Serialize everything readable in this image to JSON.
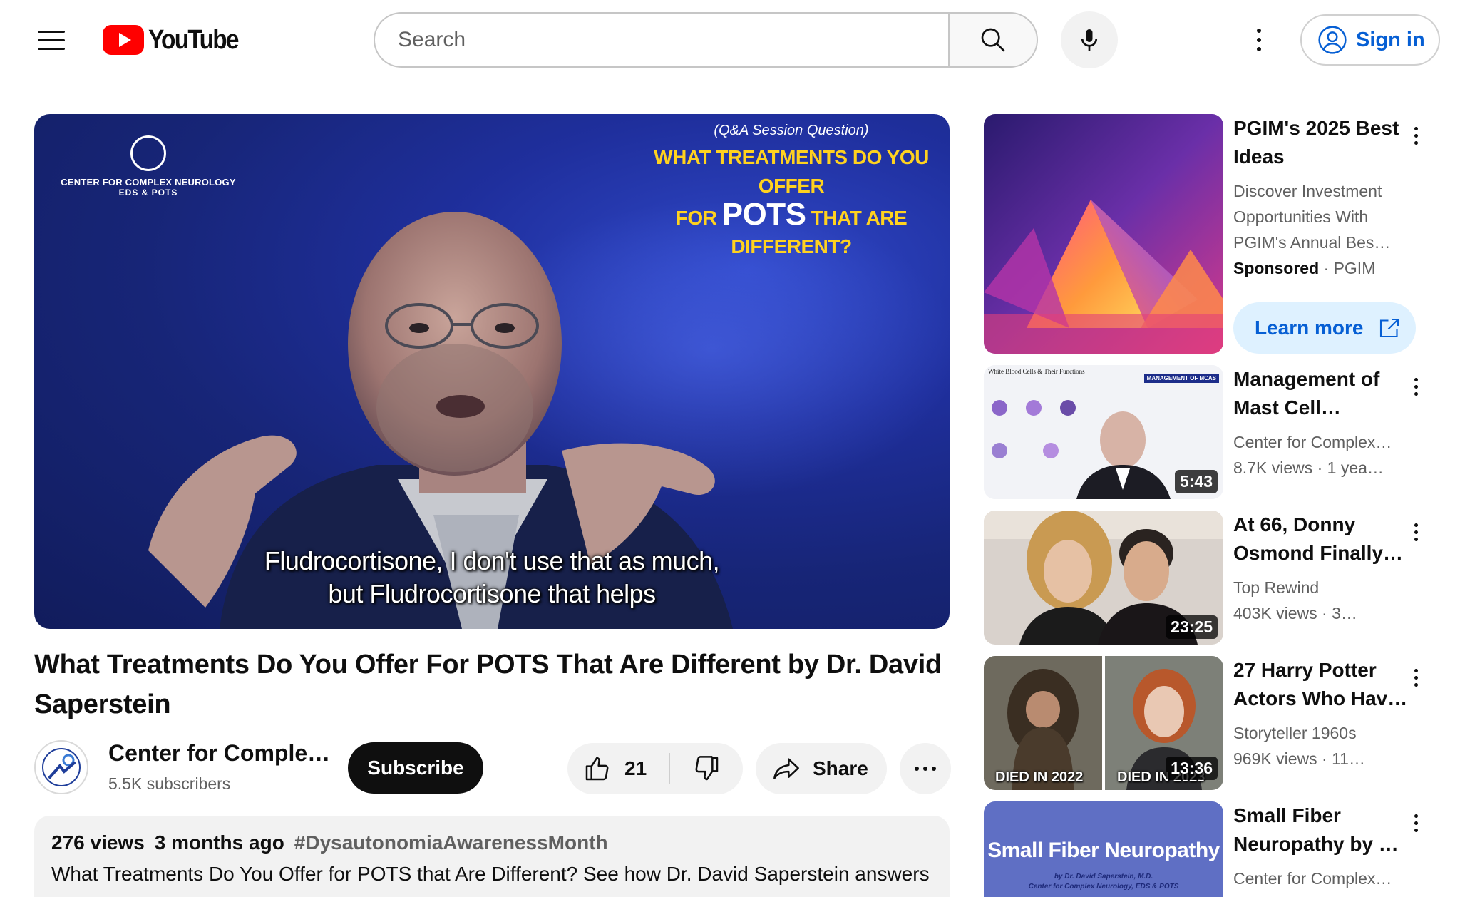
{
  "header": {
    "logo_text": "YouTube",
    "search_placeholder": "Search",
    "sign_in_label": "Sign in"
  },
  "player": {
    "overlay_org_line1": "CENTER FOR COMPLEX NEUROLOGY",
    "overlay_org_line2": "EDS & POTS",
    "overlay_caption": "(Q&A Session Question)",
    "overlay_title_line1": "WHAT TREATMENTS DO YOU OFFER",
    "overlay_title_for": "FOR",
    "overlay_title_pots": "POTS",
    "overlay_title_line2_end": "THAT ARE DIFFERENT?",
    "subtitle_line1": "Fludrocortisone, I don't use that as much,",
    "subtitle_line2": "but Fludrocortisone that helps"
  },
  "video": {
    "title": "What Treatments Do You Offer For POTS That Are Different by Dr. David Saperstein",
    "channel_name": "Center for Comple…",
    "subscribers": "5.5K subscribers",
    "subscribe_label": "Subscribe",
    "likes": "21",
    "share_label": "Share",
    "views": "276 views",
    "date": "3 months ago",
    "hashtag": "#DysautonomiaAwarenessMonth",
    "description": "What Treatments Do You Offer for POTS that Are Different? See how Dr. David Saperstein answers"
  },
  "sidebar": {
    "ad": {
      "title": "PGIM's 2025 Best Ideas",
      "description": "Discover Investment Opportunities With PGIM's Annual Bes…",
      "sponsored_label": "Sponsored",
      "advertiser": "PGIM",
      "learn_more_label": "Learn more"
    },
    "items": [
      {
        "title": "Management of Mast Cell…",
        "channel": "Center for Complex…",
        "views": "8.7K views",
        "age": "1 yea…",
        "duration": "5:43",
        "thumb_label_left": "White Blood Cells & Their Functions",
        "thumb_label_right": "MANAGEMENT OF MCAS"
      },
      {
        "title": "At 66, Donny Osmond Finally…",
        "channel": "Top Rewind",
        "views": "403K views",
        "age": "3…",
        "duration": "23:25"
      },
      {
        "title": "27 Harry Potter Actors Who Hav…",
        "channel": "Storyteller 1960s",
        "views": "969K views",
        "age": "11…",
        "duration": "13:36",
        "thumb_label_left": "DIED IN 2022",
        "thumb_label_right": "DIED IN 2023"
      },
      {
        "title": "Small Fiber Neuropathy by …",
        "channel": "Center for Complex…",
        "views": "",
        "age": "",
        "thumb_title": "Small Fiber Neuropathy",
        "thumb_sub1": "by Dr. David Saperstein, M.D.",
        "thumb_sub2": "Center for Complex Neurology, EDS & POTS"
      }
    ]
  },
  "colors": {
    "brand_red": "#ff0000",
    "link_blue": "#065fd4",
    "text_primary": "#0f0f0f",
    "text_secondary": "#606060",
    "chip_bg": "#f2f2f2"
  }
}
